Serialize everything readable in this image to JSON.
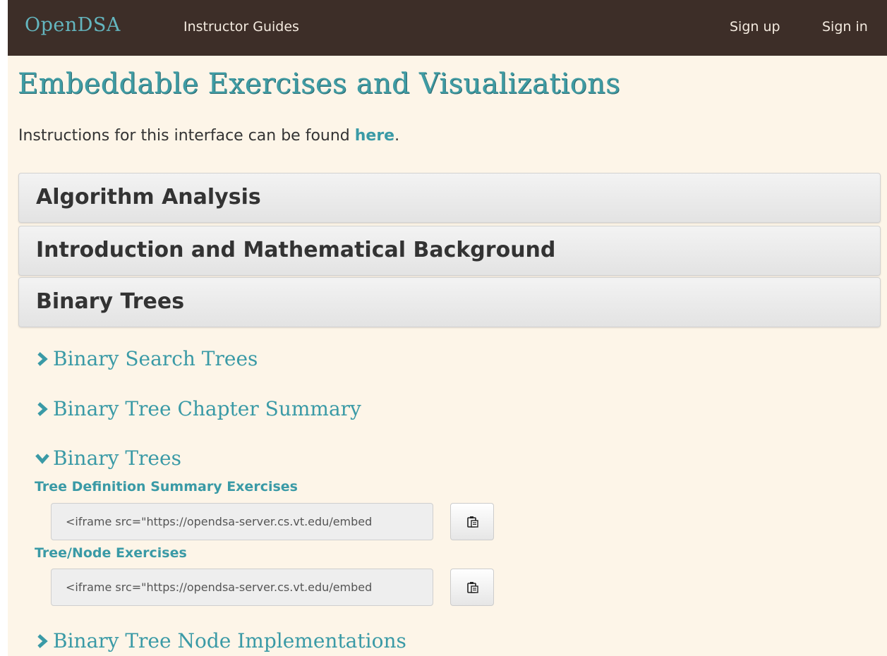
{
  "navbar": {
    "brand": "OpenDSA",
    "instructor_guides": "Instructor Guides",
    "sign_up": "Sign up",
    "sign_in": "Sign in"
  },
  "page": {
    "title": "Embeddable Exercises and Visualizations",
    "instructions_prefix": "Instructions for this interface can be found ",
    "instructions_link": "here",
    "instructions_suffix": "."
  },
  "panels": [
    {
      "label": "Algorithm Analysis"
    },
    {
      "label": "Introduction and Mathematical Background"
    },
    {
      "label": "Binary Trees"
    }
  ],
  "sections": [
    {
      "label": "Binary Search Trees",
      "icon": "chevron-right-icon",
      "expanded": false
    },
    {
      "label": "Binary Tree Chapter Summary",
      "icon": "chevron-right-icon",
      "expanded": false
    },
    {
      "label": "Binary Trees",
      "icon": "chevron-down-icon",
      "expanded": true
    },
    {
      "label": "Binary Tree Node Implementations",
      "icon": "chevron-right-icon",
      "expanded": false
    }
  ],
  "exercises": [
    {
      "title": "Tree Definition Summary Exercises",
      "embed_code": "<iframe src=\"https://opendsa-server.cs.vt.edu/embed",
      "copy_icon": "clipboard-icon"
    },
    {
      "title": "Tree/Node Exercises",
      "embed_code": "<iframe src=\"https://opendsa-server.cs.vt.edu/embed",
      "copy_icon": "clipboard-icon"
    }
  ],
  "colors": {
    "navbar_bg": "#3d2e28",
    "page_bg": "#fdf5e8",
    "accent": "#3a9aa6",
    "brand": "#64b6bf"
  }
}
